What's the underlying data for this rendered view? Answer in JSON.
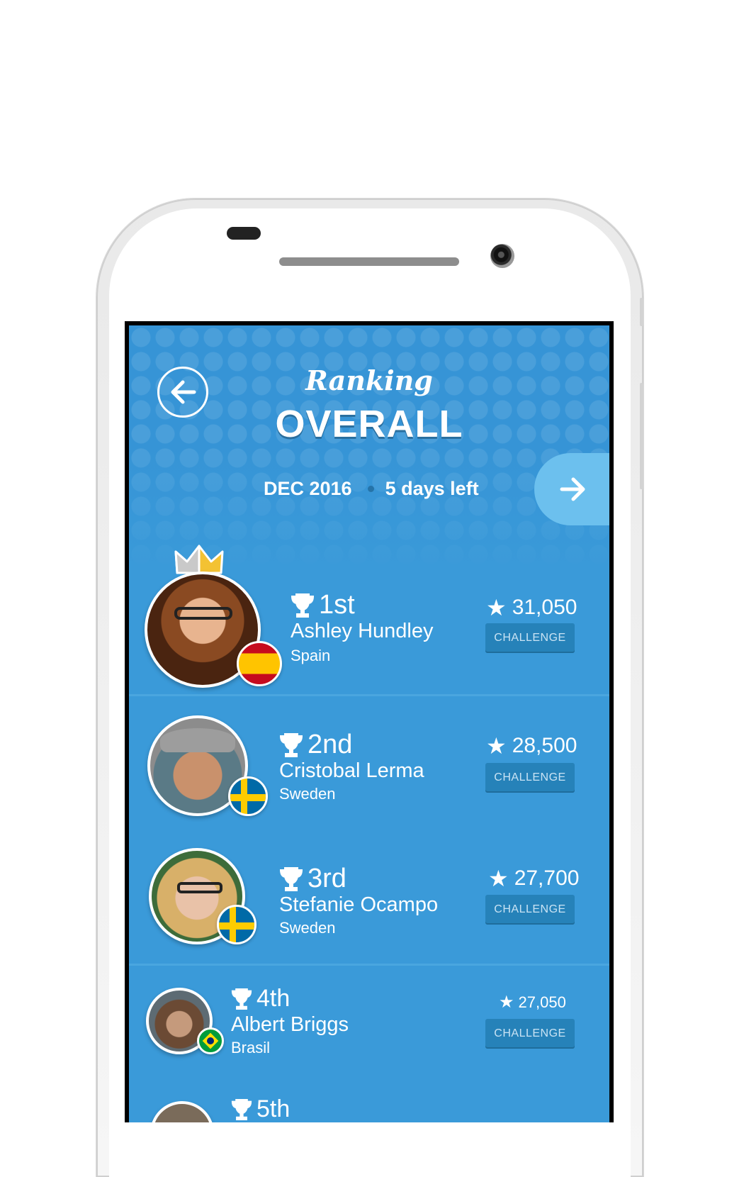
{
  "header": {
    "script_title": "Ranking",
    "main_title": "OVERALL",
    "period": "DEC 2016",
    "time_left": "5 days left"
  },
  "icons": {
    "back": "arrow-left-icon",
    "next": "arrow-right-icon",
    "trophy": "trophy-icon",
    "star": "star-icon",
    "crown": "crown-icon"
  },
  "colors": {
    "screen_bg": "#3a9ad9",
    "challenge_bg": "#2682b9",
    "next_button": "#6cc0ee"
  },
  "ranking": [
    {
      "rank": "1st",
      "name": "Ashley Hundley",
      "country": "Spain",
      "score": "31,050",
      "action": "CHALLENGE"
    },
    {
      "rank": "2nd",
      "name": "Cristobal Lerma",
      "country": "Sweden",
      "score": "28,500",
      "action": "CHALLENGE"
    },
    {
      "rank": "3rd",
      "name": "Stefanie Ocampo",
      "country": "Sweden",
      "score": "27,700",
      "action": "CHALLENGE"
    },
    {
      "rank": "4th",
      "name": "Albert Briggs",
      "country": "Brasil",
      "score": "27,050",
      "action": "CHALLENGE"
    },
    {
      "rank": "5th",
      "name": "",
      "country": "",
      "score": "",
      "action": ""
    }
  ]
}
